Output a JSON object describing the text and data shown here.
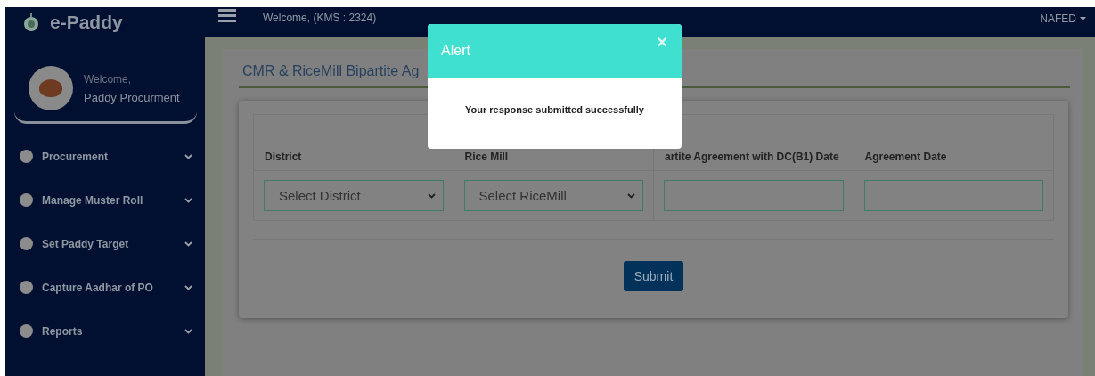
{
  "brand": {
    "title": "e-Paddy"
  },
  "topbar": {
    "welcome": "Welcome, (KMS : 2324)",
    "user_menu": "NAFED"
  },
  "profile": {
    "greeting": "Welcome,",
    "name": "Paddy Procurment"
  },
  "sidebar": {
    "items": [
      {
        "label": "Procurement",
        "expanded": false
      },
      {
        "label": "Manage Muster Roll",
        "expanded": false
      },
      {
        "label": "Set Paddy Target",
        "expanded": false
      },
      {
        "label": "Capture Aadhar of PO",
        "expanded": false
      },
      {
        "label": "Reports",
        "expanded": false
      }
    ]
  },
  "page": {
    "title": "CMR & RiceMill Bipartite Ag"
  },
  "table": {
    "columns": [
      {
        "label": "District"
      },
      {
        "label": "Rice Mill"
      },
      {
        "label": "artite Agreement with DC(B1) Date"
      },
      {
        "label": "Agreement Date"
      }
    ],
    "fields": [
      {
        "kind": "select",
        "placeholder": "Select District"
      },
      {
        "kind": "select",
        "placeholder": "Select RiceMill"
      },
      {
        "kind": "text"
      },
      {
        "kind": "text"
      }
    ]
  },
  "submit": "Submit",
  "alert": {
    "title": "Alert",
    "close": "×",
    "message": "Your response submitted successfully"
  }
}
